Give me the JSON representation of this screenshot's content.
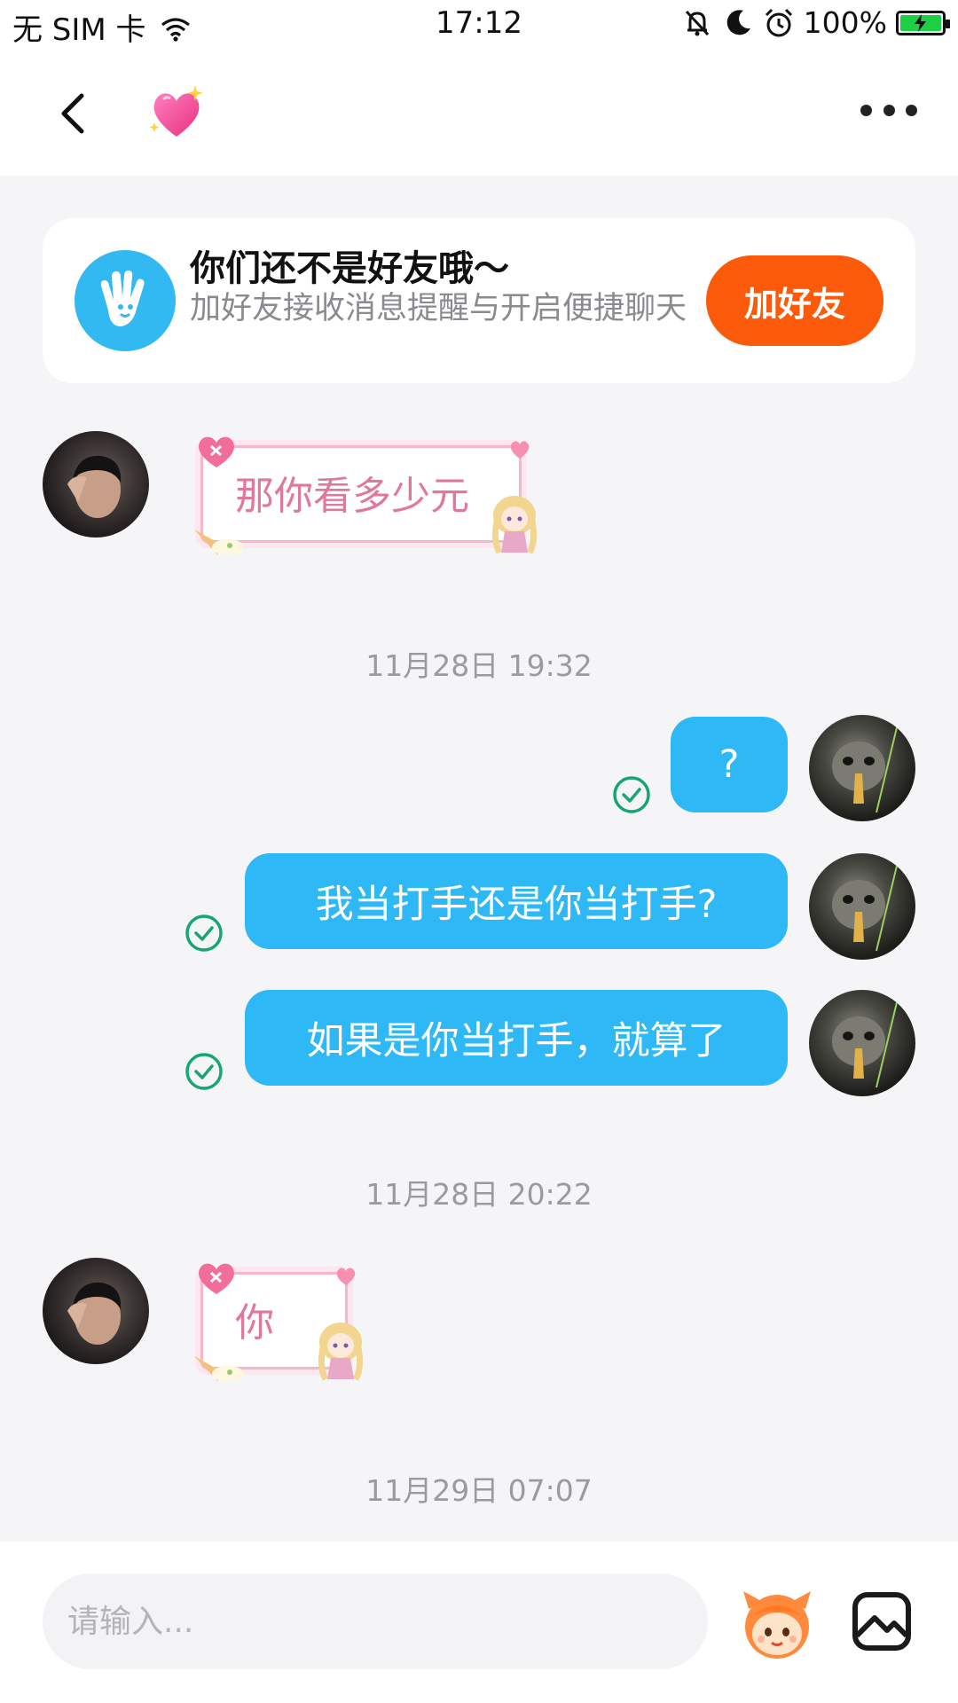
{
  "status_bar": {
    "carrier": "无 SIM 卡",
    "time": "17:12",
    "battery": "100%",
    "icons": [
      "wifi-icon",
      "mute-bell-icon",
      "moon-icon",
      "alarm-icon",
      "battery-charging-icon"
    ]
  },
  "nav": {
    "back_icon": "chevron-left-icon",
    "title_icon": "sparkling-heart-icon",
    "more_icon": "more-dots-icon"
  },
  "friend_banner": {
    "title": "你们还不是好友哦～",
    "subtitle": "加好友接收消息提醒与开启便捷聊天",
    "button": "加好友",
    "icon": "waving-hand-icon",
    "accent": "#fa5a0a"
  },
  "messages": [
    {
      "from": "peer",
      "type": "sticker-text",
      "text": "那你看多少元"
    },
    {
      "type": "timestamp",
      "text": "11月28日 19:32"
    },
    {
      "from": "self",
      "type": "text",
      "text": "?",
      "read": true
    },
    {
      "from": "self",
      "type": "text",
      "text": "我当打手还是你当打手?",
      "read": true
    },
    {
      "from": "self",
      "type": "text",
      "text": "如果是你当打手，就算了",
      "read": true
    },
    {
      "type": "timestamp",
      "text": "11月28日 20:22"
    },
    {
      "from": "peer",
      "type": "sticker-text",
      "text": "你"
    },
    {
      "type": "timestamp",
      "text": "11月29日 07:07"
    }
  ],
  "input": {
    "placeholder": "请输入...",
    "value": "",
    "sticker_icon": "emoji-mascot-icon",
    "image_icon": "image-icon"
  },
  "colors": {
    "bubble_out": "#2eb8f5",
    "check": "#17a673",
    "sticker_text": "#e0779d",
    "background": "#f5f5f7"
  }
}
